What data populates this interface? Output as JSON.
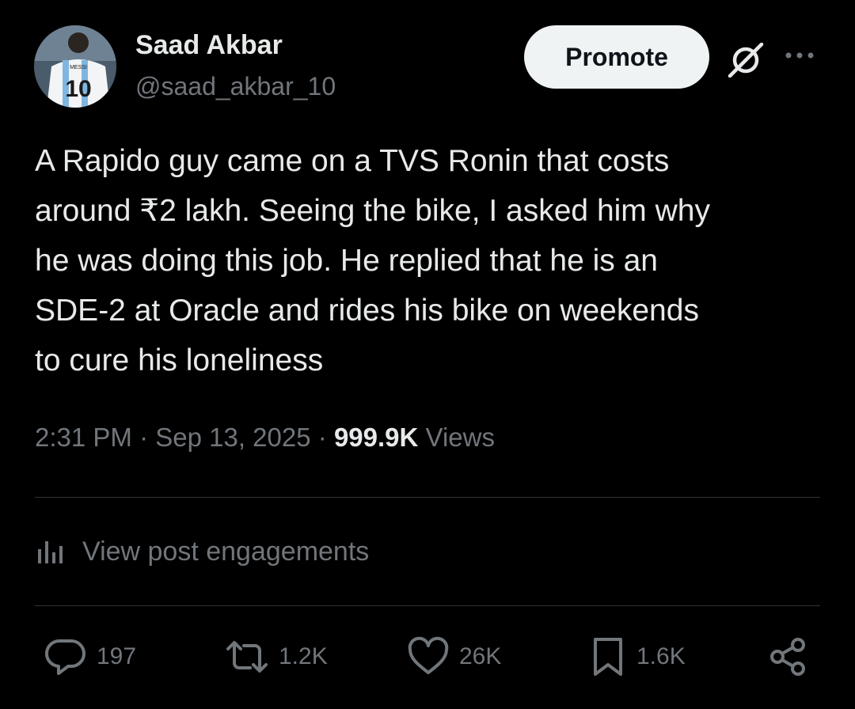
{
  "author": {
    "display_name": "Saad Akbar",
    "handle": "@saad_akbar_10",
    "avatar_jersey_text": "MESSI",
    "avatar_jersey_number": "10"
  },
  "header": {
    "promote_label": "Promote",
    "grok_icon": "grok-icon",
    "more_icon": "more-icon"
  },
  "post": {
    "text": "A Rapido guy came on a TVS Ronin that costs\naround ₹2 lakh. Seeing the bike, I asked him why\nhe was doing this job. He replied that he is an\nSDE-2 at Oracle and rides his bike on weekends\nto cure his loneliness",
    "time": "2:31 PM",
    "separator": "·",
    "date": "Sep 13, 2025",
    "views_count": "999.9K",
    "views_label": "Views"
  },
  "engagements": {
    "label": "View post engagements",
    "icon": "analytics-icon"
  },
  "actions": {
    "replies": "197",
    "reposts": "1.2K",
    "likes": "26K",
    "bookmarks": "1.6K"
  },
  "colors": {
    "background": "#000000",
    "text_primary": "#e7e9ea",
    "text_secondary": "#71767b",
    "divider": "#2f3336",
    "button_bg": "#eff3f4"
  }
}
